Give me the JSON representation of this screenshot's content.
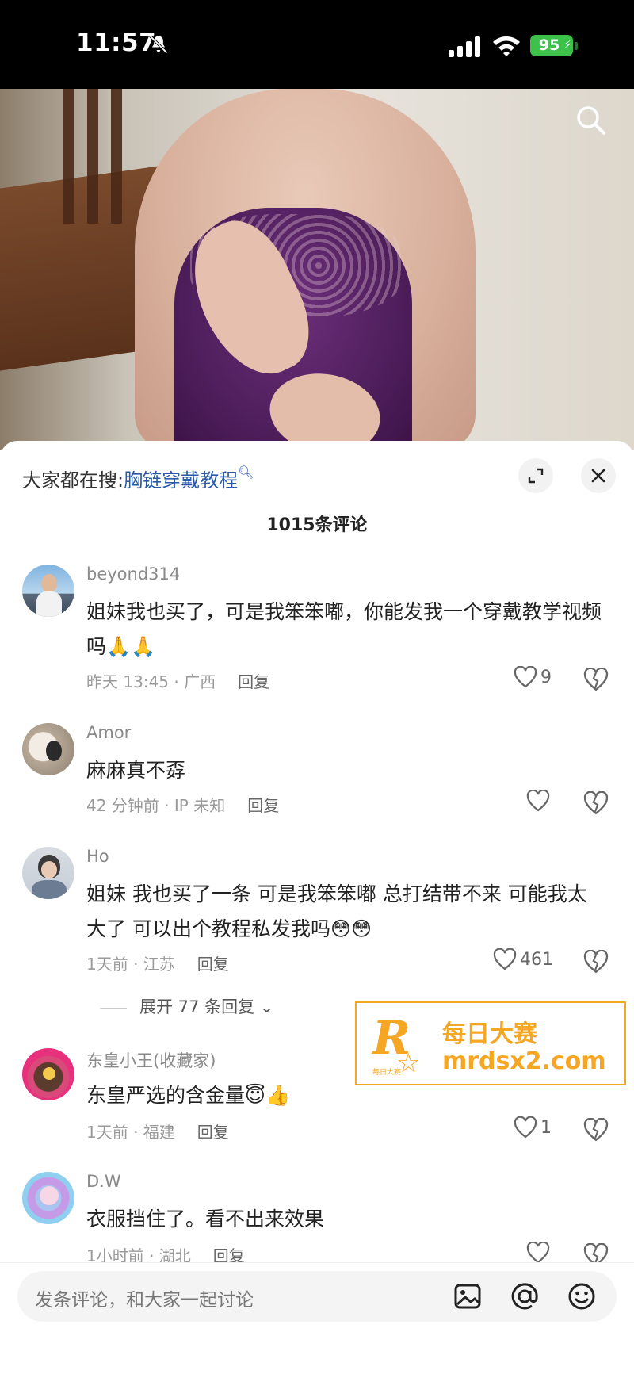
{
  "status_bar": {
    "time": "11:57",
    "battery": "95"
  },
  "comments_panel": {
    "search_hint_label": "大家都在搜:",
    "search_hint_term": "胸链穿戴教程",
    "comment_count": "1015条评论"
  },
  "comments": [
    {
      "username": "beyond314",
      "text": "姐妹我也买了，可是我笨笨嘟，你能发我一个穿戴教学视频吗🙏🙏",
      "meta": "昨天 13:45 · 广西",
      "reply": "回复",
      "likes": "9"
    },
    {
      "username": "Amor",
      "text": "麻麻真不孬",
      "meta": "42 分钟前 · IP 未知",
      "reply": "回复",
      "likes": ""
    },
    {
      "username": "Ho",
      "text": "姐妹  我也买了一条  可是我笨笨嘟  总打结带不来  可能我太大了   可以出个教程私发我吗😳😳",
      "meta": "1天前 · 江苏",
      "reply": "回复",
      "likes": "461",
      "expand_replies": "展开 77 条回复 ⌄"
    },
    {
      "username": "东皇小王(收藏家)",
      "text": "东皇严选的含金量😇👍",
      "meta": "1天前 · 福建",
      "reply": "回复",
      "likes": "1"
    },
    {
      "username": "D.W",
      "text": "衣服挡住了。看不出来效果",
      "meta": "1小时前 · 湖北",
      "reply": "回复",
      "likes": ""
    }
  ],
  "watermark": {
    "letter": "R",
    "small_text": "每日大赛",
    "title": "每日大赛",
    "url": "mrdsx2.com"
  },
  "input_bar": {
    "placeholder": "发条评论，和大家一起讨论"
  },
  "icons": {
    "status": [
      "bell-off-icon",
      "signal-icon",
      "wifi-icon",
      "battery-icon"
    ],
    "video": [
      "search-icon"
    ],
    "panel": [
      "expand-icon",
      "close-icon"
    ],
    "comment_actions": [
      "heart-icon",
      "broken-heart-icon"
    ],
    "input": [
      "image-icon",
      "at-icon",
      "emoji-icon"
    ]
  },
  "colors": {
    "link_blue": "#2a59a8",
    "watermark_orange": "#f5a623",
    "battery_green": "#3cc24b"
  }
}
